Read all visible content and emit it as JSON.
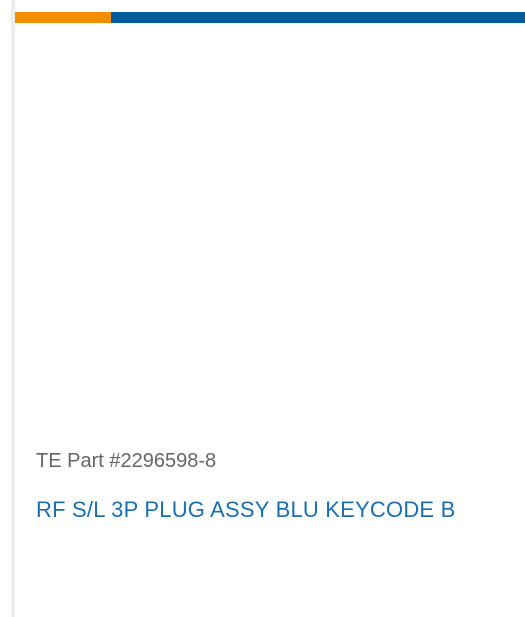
{
  "product_card": {
    "part_number": "TE Part #2296598-8",
    "title": "RF S/L 3P PLUG ASSY BLU KEYCODE B"
  },
  "colors": {
    "accent_orange": "#f28d00",
    "accent_blue": "#005e9e",
    "title_link": "#1a6fb0",
    "part_number_text": "#666666"
  }
}
